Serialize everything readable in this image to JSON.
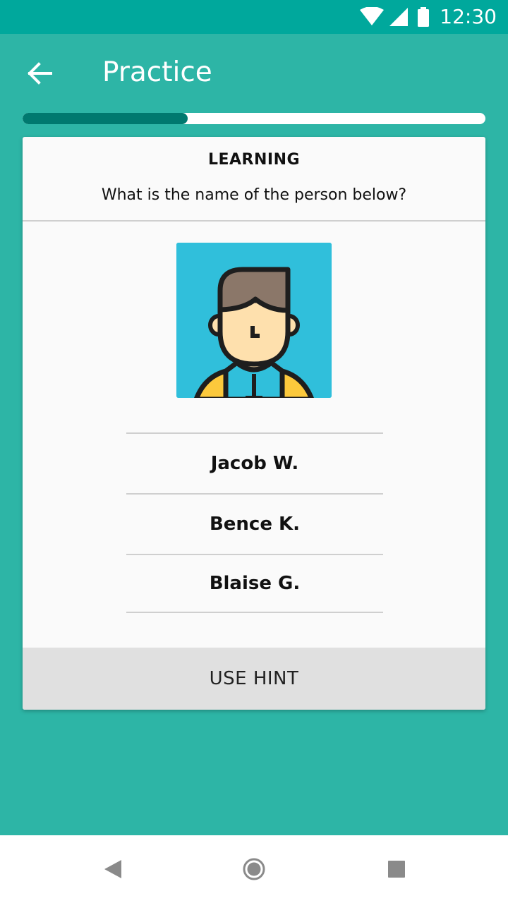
{
  "status_bar": {
    "time": "12:30",
    "icons": [
      "wifi-icon",
      "cell-signal-icon",
      "battery-icon"
    ]
  },
  "app_bar": {
    "back_icon": "arrow-back-icon",
    "title": "Practice"
  },
  "progress": {
    "fraction": 0.356,
    "track_color": "#ffffff",
    "fill_color": "#00796f"
  },
  "card": {
    "mode_label": "LEARNING",
    "question": "What is the name of the person below?",
    "portrait_icon": "person-avatar-icon",
    "answers": [
      "Jacob W.",
      "Bence K.",
      "Blaise G."
    ],
    "hint_label": "USE HINT"
  },
  "nav_bar": {
    "icons": [
      "nav-back-icon",
      "nav-home-icon",
      "nav-recents-icon"
    ]
  },
  "colors": {
    "background": "#2db5a6",
    "status_bar": "#00a89c",
    "card": "#fafafa",
    "hint_button": "#e0e0e0",
    "portrait_background": "#30bfdb"
  }
}
